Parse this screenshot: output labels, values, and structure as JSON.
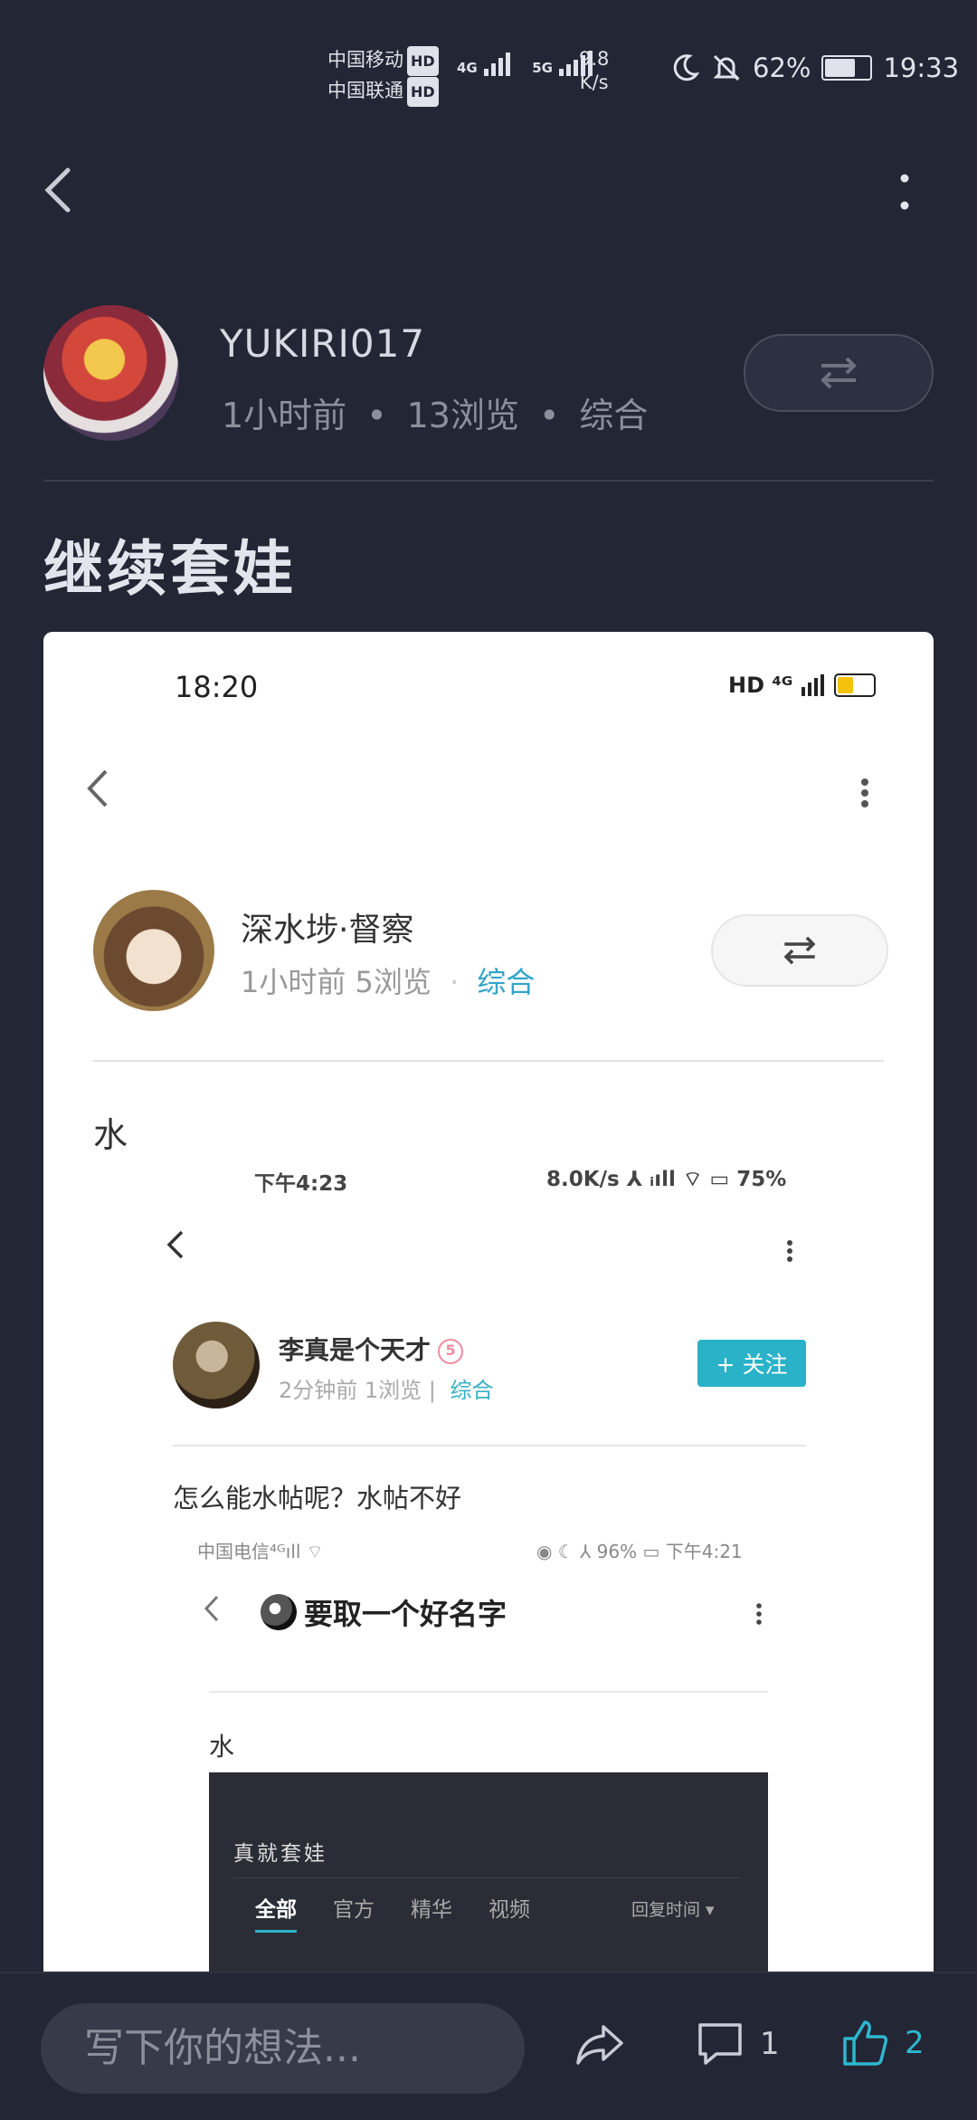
{
  "status_bar": {
    "carrier1": "中国移动",
    "carrier2": "中国联通",
    "hd": "HD",
    "network1": "4G",
    "network2": "5G",
    "speed_value": "9.8",
    "speed_unit": "K/s",
    "battery": "62%",
    "time": "19:33",
    "battery_level": 0.62
  },
  "post": {
    "author": "YUKIRI017",
    "time_ago": "1小时前",
    "views": "13浏览",
    "category": "综合",
    "dot": "•",
    "title": "继续套娃"
  },
  "embedded": {
    "time": "18:20",
    "icons": "HD ⁴ᴳ",
    "author": "深水埗·督察",
    "meta": "1小时前  5浏览",
    "dot": "·",
    "category": "综合",
    "body": "水",
    "nested": {
      "status_left": "下午4:23",
      "status_right": "8.0K/s ⅄ ᵢıll ⌔ ▭ 75%",
      "author": "李真是个天才",
      "badge": "5",
      "meta": "2分钟前 1浏览 |",
      "category": "综合",
      "follow": "+ 关注",
      "body": "怎么能水帖呢？水帖不好",
      "inner": {
        "status_left": "中国电信⁴ᴳıll ⌔",
        "status_right": "◉ ☾ ⅄ 96% ▭ 下午4:21",
        "title": "要取一个好名字",
        "body": "水",
        "dark_title": "真就套娃",
        "tabs": [
          "全部",
          "官方",
          "精华",
          "视频"
        ],
        "sort": "回复时间 ▾"
      }
    }
  },
  "bottom": {
    "placeholder": "写下你的想法...",
    "comment_count": "1",
    "like_count": "2"
  },
  "colors": {
    "background": "#232634",
    "accent": "#2fb6d0"
  }
}
